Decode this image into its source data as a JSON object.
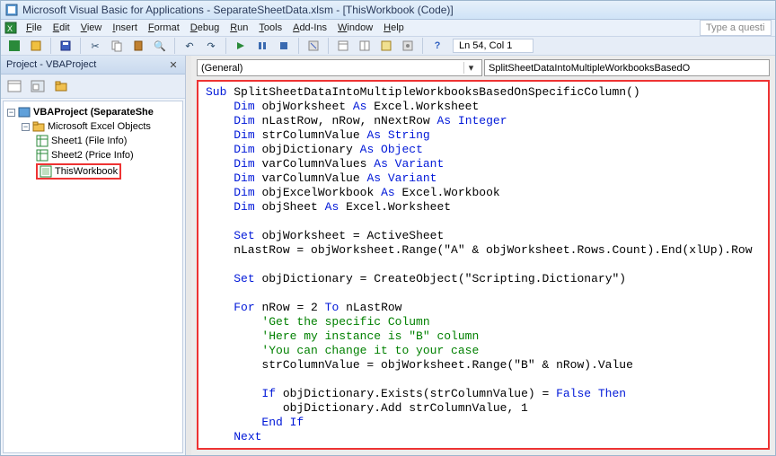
{
  "titlebar": {
    "app_icon": "vba-icon",
    "title": "Microsoft Visual Basic for Applications - SeparateSheetData.xlsm - [ThisWorkbook (Code)]"
  },
  "menubar": [
    "File",
    "Edit",
    "View",
    "Insert",
    "Format",
    "Debug",
    "Run",
    "Tools",
    "Add-Ins",
    "Window",
    "Help"
  ],
  "typebox": {
    "placeholder": "Type a questi"
  },
  "toolbar": {
    "status": "Ln 54, Col 1"
  },
  "project_panel": {
    "title": "Project - VBAProject",
    "tree": {
      "root": "VBAProject (SeparateShe",
      "folder": "Microsoft Excel Objects",
      "items": [
        "Sheet1 (File Info)",
        "Sheet2 (Price Info)",
        "ThisWorkbook"
      ]
    }
  },
  "code_dropdowns": {
    "left": "(General)",
    "right": "SplitSheetDataIntoMultipleWorkbooksBasedO"
  },
  "code": {
    "tokens": [
      {
        "t": "kw",
        "v": "Sub "
      },
      {
        "t": "txt",
        "v": "SplitSheetDataIntoMultipleWorkbooksBasedOnSpecificColumn()"
      },
      {
        "t": "nl"
      },
      {
        "t": "txt",
        "v": "    "
      },
      {
        "t": "kw",
        "v": "Dim "
      },
      {
        "t": "txt",
        "v": "objWorksheet "
      },
      {
        "t": "kw",
        "v": "As "
      },
      {
        "t": "txt",
        "v": "Excel.Worksheet"
      },
      {
        "t": "nl"
      },
      {
        "t": "txt",
        "v": "    "
      },
      {
        "t": "kw",
        "v": "Dim "
      },
      {
        "t": "txt",
        "v": "nLastRow, nRow, nNextRow "
      },
      {
        "t": "kw",
        "v": "As Integer"
      },
      {
        "t": "nl"
      },
      {
        "t": "txt",
        "v": "    "
      },
      {
        "t": "kw",
        "v": "Dim "
      },
      {
        "t": "txt",
        "v": "strColumnValue "
      },
      {
        "t": "kw",
        "v": "As String"
      },
      {
        "t": "nl"
      },
      {
        "t": "txt",
        "v": "    "
      },
      {
        "t": "kw",
        "v": "Dim "
      },
      {
        "t": "txt",
        "v": "objDictionary "
      },
      {
        "t": "kw",
        "v": "As Object"
      },
      {
        "t": "nl"
      },
      {
        "t": "txt",
        "v": "    "
      },
      {
        "t": "kw",
        "v": "Dim "
      },
      {
        "t": "txt",
        "v": "varColumnValues "
      },
      {
        "t": "kw",
        "v": "As Variant"
      },
      {
        "t": "nl"
      },
      {
        "t": "txt",
        "v": "    "
      },
      {
        "t": "kw",
        "v": "Dim "
      },
      {
        "t": "txt",
        "v": "varColumnValue "
      },
      {
        "t": "kw",
        "v": "As Variant"
      },
      {
        "t": "nl"
      },
      {
        "t": "txt",
        "v": "    "
      },
      {
        "t": "kw",
        "v": "Dim "
      },
      {
        "t": "txt",
        "v": "objExcelWorkbook "
      },
      {
        "t": "kw",
        "v": "As "
      },
      {
        "t": "txt",
        "v": "Excel.Workbook"
      },
      {
        "t": "nl"
      },
      {
        "t": "txt",
        "v": "    "
      },
      {
        "t": "kw",
        "v": "Dim "
      },
      {
        "t": "txt",
        "v": "objSheet "
      },
      {
        "t": "kw",
        "v": "As "
      },
      {
        "t": "txt",
        "v": "Excel.Worksheet"
      },
      {
        "t": "nl"
      },
      {
        "t": "nl"
      },
      {
        "t": "txt",
        "v": "    "
      },
      {
        "t": "kw",
        "v": "Set "
      },
      {
        "t": "txt",
        "v": "objWorksheet = ActiveSheet"
      },
      {
        "t": "nl"
      },
      {
        "t": "txt",
        "v": "    nLastRow = objWorksheet.Range(\"A\" & objWorksheet.Rows.Count).End(xlUp).Row"
      },
      {
        "t": "nl"
      },
      {
        "t": "nl"
      },
      {
        "t": "txt",
        "v": "    "
      },
      {
        "t": "kw",
        "v": "Set "
      },
      {
        "t": "txt",
        "v": "objDictionary = CreateObject(\"Scripting.Dictionary\")"
      },
      {
        "t": "nl"
      },
      {
        "t": "nl"
      },
      {
        "t": "txt",
        "v": "    "
      },
      {
        "t": "kw",
        "v": "For "
      },
      {
        "t": "txt",
        "v": "nRow = 2 "
      },
      {
        "t": "kw",
        "v": "To "
      },
      {
        "t": "txt",
        "v": "nLastRow"
      },
      {
        "t": "nl"
      },
      {
        "t": "txt",
        "v": "        "
      },
      {
        "t": "cmt",
        "v": "'Get the specific Column"
      },
      {
        "t": "nl"
      },
      {
        "t": "txt",
        "v": "        "
      },
      {
        "t": "cmt",
        "v": "'Here my instance is \"B\" column"
      },
      {
        "t": "nl"
      },
      {
        "t": "txt",
        "v": "        "
      },
      {
        "t": "cmt",
        "v": "'You can change it to your case"
      },
      {
        "t": "nl"
      },
      {
        "t": "txt",
        "v": "        strColumnValue = objWorksheet.Range(\"B\" & nRow).Value"
      },
      {
        "t": "nl"
      },
      {
        "t": "nl"
      },
      {
        "t": "txt",
        "v": "        "
      },
      {
        "t": "kw",
        "v": "If "
      },
      {
        "t": "txt",
        "v": "objDictionary.Exists(strColumnValue) = "
      },
      {
        "t": "kw",
        "v": "False Then"
      },
      {
        "t": "nl"
      },
      {
        "t": "txt",
        "v": "           objDictionary.Add strColumnValue, 1"
      },
      {
        "t": "nl"
      },
      {
        "t": "txt",
        "v": "        "
      },
      {
        "t": "kw",
        "v": "End If"
      },
      {
        "t": "nl"
      },
      {
        "t": "txt",
        "v": "    "
      },
      {
        "t": "kw",
        "v": "Next"
      },
      {
        "t": "nl"
      }
    ]
  }
}
